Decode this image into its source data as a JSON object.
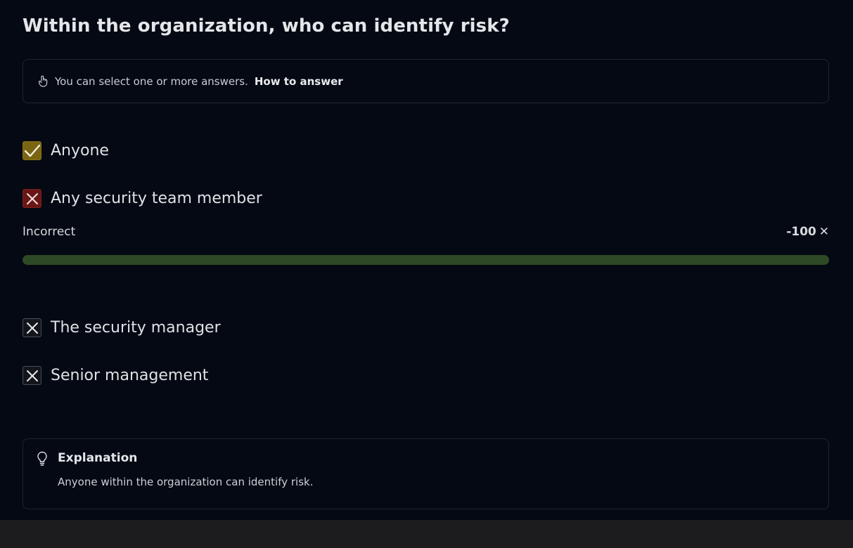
{
  "question": {
    "title": "Within the organization, who can identify risk?"
  },
  "hint": {
    "icon": "hand-pointer-icon",
    "text": "You can select one or more answers.",
    "link_label": "How to answer"
  },
  "options": [
    {
      "label": "Anyone",
      "state": "selected-correct",
      "icon": "check-icon"
    },
    {
      "label": "Any security team member",
      "state": "selected-incorrect",
      "icon": "x-icon"
    },
    {
      "label": "The security manager",
      "state": "not-selected",
      "icon": "x-icon"
    },
    {
      "label": "Senior management",
      "state": "not-selected",
      "icon": "x-icon"
    }
  ],
  "feedback": {
    "status": "Incorrect",
    "score": "-100",
    "close_icon": "close-icon",
    "progress_fraction": 1.0
  },
  "explanation": {
    "icon": "lightbulb-icon",
    "title": "Explanation",
    "text": "Anyone within the organization can identify risk."
  },
  "colors": {
    "background": "#050913",
    "check_fill": "#7a6512",
    "wrong_fill": "#6a1616",
    "progress_fill": "#2d4a25"
  }
}
